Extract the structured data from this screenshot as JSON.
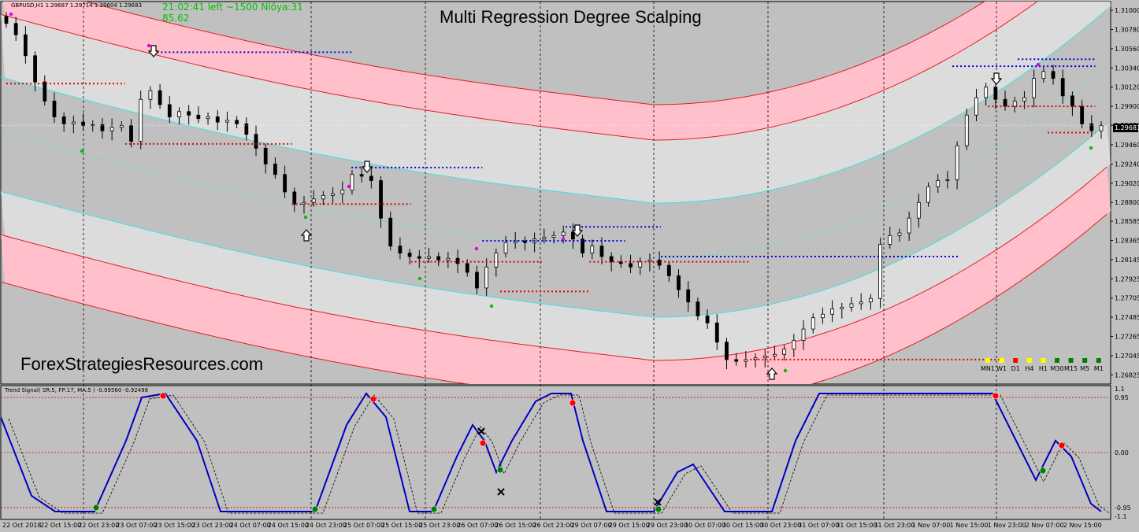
{
  "window": {
    "symbol_header": "GBPUSD,H1  1.29687 1.29714 1.29604 1.29683",
    "clock_text": "21:02:41 left ~1500 Nlöya:31",
    "value_text": "85.62",
    "title": "Multi Regression Degree Scalping",
    "watermark": "ForexStrategiesResources.com",
    "current_price": "1.29683",
    "indicator_label": "Trend Signal( SR:5, FP:17, MA:5 ) -0.99560 -0.92498"
  },
  "colors": {
    "background": "#c0c0c0",
    "band_outer": "#ffc0cb",
    "band_inner": "#dcdcdc",
    "band_edge_red": "#e02020",
    "band_edge_cyan": "#40e0e0",
    "level_red": "#e00000",
    "level_blue": "#0000e0",
    "signal_line": "#0000c0",
    "signal_dot_green": "#008000",
    "signal_dot_red": "#ff0000"
  },
  "timeframes": [
    {
      "label": "MN1",
      "color": "#ffff00"
    },
    {
      "label": "W1",
      "color": "#ffff00"
    },
    {
      "label": "D1",
      "color": "#ff0000"
    },
    {
      "label": "H4",
      "color": "#ffff00"
    },
    {
      "label": "H1",
      "color": "#ffff00"
    },
    {
      "label": "M30",
      "color": "#008000"
    },
    {
      "label": "M15",
      "color": "#008000"
    },
    {
      "label": "M5",
      "color": "#008000"
    },
    {
      "label": "M1",
      "color": "#008000"
    }
  ],
  "chart_data": [
    {
      "type": "candlestick",
      "title": "Multi Regression Degree Scalping",
      "y_ticks": [
        "1.31000",
        "1.30780",
        "1.30560",
        "1.30340",
        "1.30120",
        "1.29900",
        "1.29683",
        "1.29460",
        "1.29240",
        "1.29020",
        "1.28800",
        "1.28585",
        "1.28365",
        "1.28145",
        "1.27925",
        "1.27705",
        "1.27485",
        "1.27265",
        "1.27045",
        "1.26825"
      ],
      "ylim": [
        1.2672,
        1.311
      ],
      "current_price": 1.29683,
      "closes": [
        1.3085,
        1.3072,
        1.3048,
        1.3018,
        1.2996,
        1.2978,
        1.297,
        1.2972,
        1.2968,
        1.2969,
        1.2962,
        1.2966,
        1.2968,
        1.295,
        1.2998,
        1.3008,
        1.2992,
        1.2978,
        1.2984,
        1.298,
        1.2976,
        1.2978,
        1.2972,
        1.2974,
        1.297,
        1.2958,
        1.2942,
        1.2924,
        1.2912,
        1.2892,
        1.2878,
        1.288,
        1.2884,
        1.2888,
        1.289,
        1.2894,
        1.2912,
        1.291,
        1.2905,
        1.2862,
        1.283,
        1.2822,
        1.2818,
        1.2816,
        1.2818,
        1.2814,
        1.2816,
        1.281,
        1.28,
        1.2782,
        1.2806,
        1.2822,
        1.2834,
        1.2836,
        1.2834,
        1.2838,
        1.284,
        1.2842,
        1.2846,
        1.2838,
        1.2822,
        1.283,
        1.2818,
        1.2812,
        1.281,
        1.2806,
        1.2812,
        1.2814,
        1.2808,
        1.2796,
        1.278,
        1.2766,
        1.275,
        1.2742,
        1.272,
        1.27,
        1.2698,
        1.27,
        1.2702,
        1.2704,
        1.2706,
        1.2712,
        1.2722,
        1.2735,
        1.2748,
        1.2752,
        1.2758,
        1.276,
        1.2764,
        1.2766,
        1.277,
        1.2832,
        1.2842,
        1.2845,
        1.2862,
        1.288,
        1.2898,
        1.2905,
        1.2906,
        1.2945,
        1.298,
        1.3,
        1.3012,
        1.2998,
        1.299,
        1.2996,
        1.3,
        1.3022,
        1.303,
        1.3022,
        1.3002,
        1.299,
        1.297,
        1.2962,
        1.2968
      ]
    },
    {
      "type": "line",
      "indicator": "Trend Signal",
      "y_ticks": [
        "1.1",
        "0.95",
        "0.00",
        "-0.95",
        "-1.1"
      ],
      "ylim": [
        -1.1,
        1.1
      ],
      "levels": [
        0.95,
        0,
        -0.95
      ],
      "x_ticks": [
        "22 Oct 2018",
        "22 Oct 15:00",
        "22 Oct 23:00",
        "23 Oct 07:00",
        "23 Oct 15:00",
        "23 Oct 23:00",
        "24 Oct 07:00",
        "24 Oct 15:00",
        "24 Oct 23:00",
        "25 Oct 07:00",
        "25 Oct 15:00",
        "25 Oct 23:00",
        "26 Oct 07:00",
        "26 Oct 15:00",
        "26 Oct 23:00",
        "29 Oct 07:00",
        "29 Oct 15:00",
        "29 Oct 23:00",
        "30 Oct 07:00",
        "30 Oct 15:00",
        "30 Oct 23:00",
        "31 Oct 07:00",
        "31 Oct 15:00",
        "31 Oct 23:00",
        "1 Nov 07:00",
        "1 Nov 15:00",
        "1 Nov 23:00",
        "2 Nov 07:00",
        "2 Nov 15:00"
      ]
    }
  ]
}
